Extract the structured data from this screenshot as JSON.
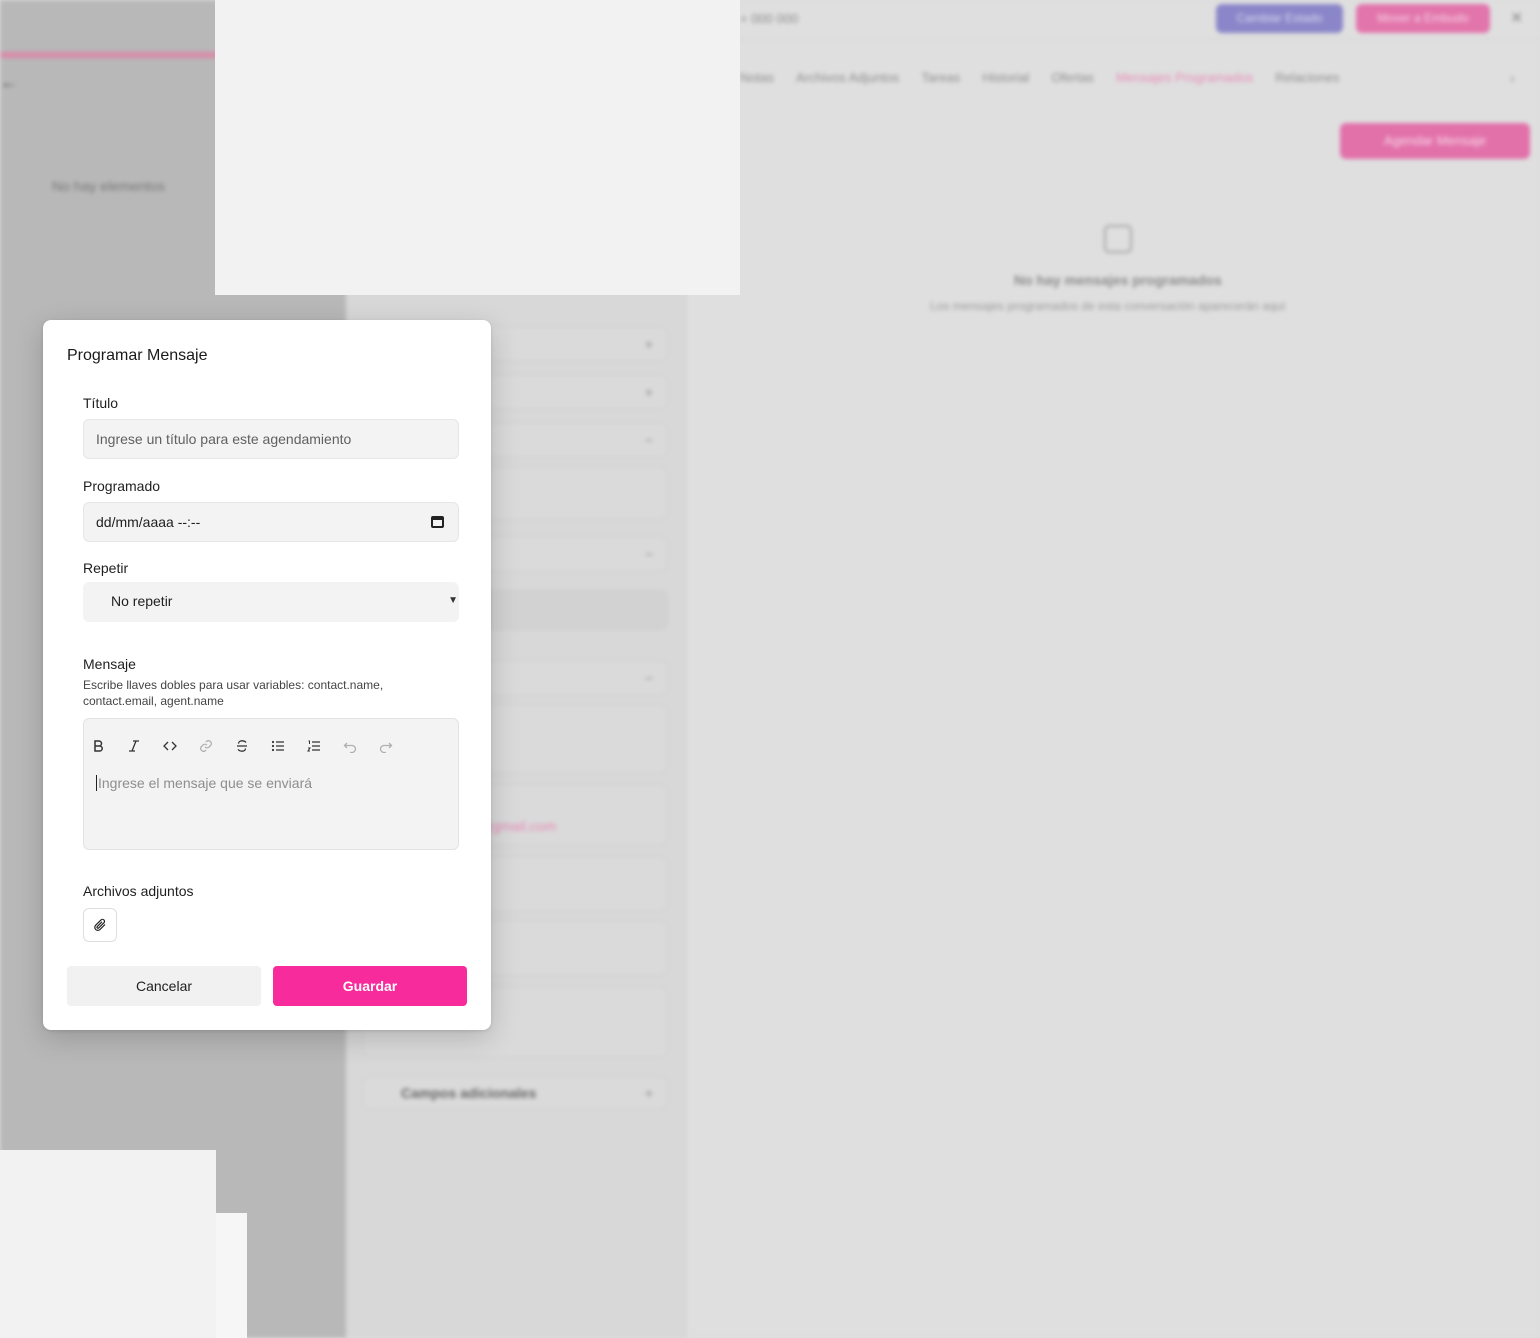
{
  "modal": {
    "title": "Programar Mensaje",
    "title_field": {
      "label": "Título",
      "placeholder": "Ingrese un título para este agendamiento"
    },
    "schedule_field": {
      "label": "Programado",
      "placeholder": "dd/mm/aaaa --:--"
    },
    "repeat_field": {
      "label": "Repetir",
      "value": "No repetir"
    },
    "message_field": {
      "label": "Mensaje",
      "hint": "Escribe llaves dobles para usar variables: contact.name, contact.email, agent.name",
      "placeholder": "Ingrese el mensaje que se enviará",
      "toolbar": [
        "bold-icon",
        "italic-icon",
        "code-icon",
        "link-icon",
        "strikethrough-icon",
        "bullet-list-icon",
        "ordered-list-icon",
        "undo-icon",
        "redo-icon"
      ]
    },
    "attachments": {
      "label": "Archivos adjuntos",
      "icon": "paperclip-icon"
    },
    "cancel_label": "Cancelar",
    "save_label": "Guardar"
  },
  "background": {
    "left_empty": "No hay elementos",
    "phone": "+ 000 000",
    "btn_violet": "Cambiar Estado",
    "btn_pink": "Mover a Embudo",
    "tabs": [
      "Notas",
      "Archivos Adjuntos",
      "Tareas",
      "Historial",
      "Ofertas",
      "Mensajes Programados",
      "Relaciones"
    ],
    "active_tab": "Mensajes Programados",
    "add_button": "Agendar Mensaje",
    "empty_title": "No hay mensajes programados",
    "empty_subtitle": "Los mensajes programados de esta conversación aparecerán aquí",
    "email": "@gmail.com",
    "cards": [
      "Campos adicionales"
    ]
  },
  "colors": {
    "accent": "#f72b9c",
    "secondary": "#5b52c7"
  }
}
